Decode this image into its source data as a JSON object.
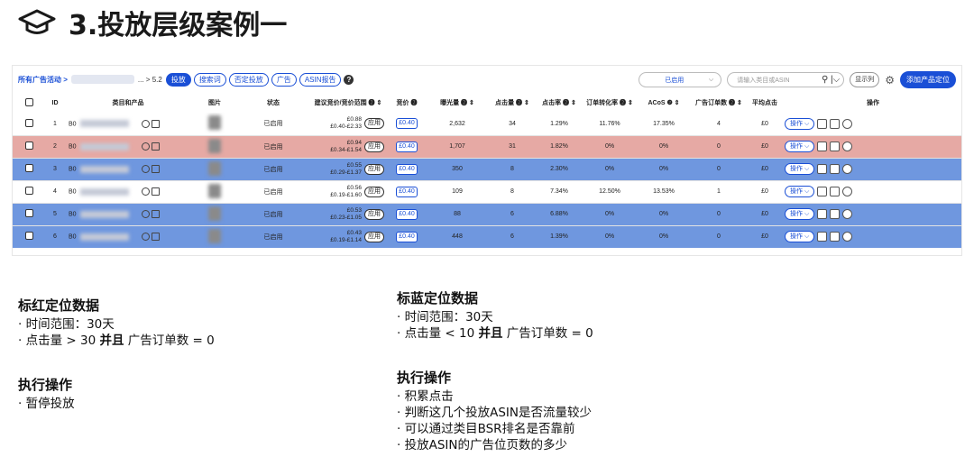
{
  "slide": {
    "title": "3.投放层级案例一",
    "icon": "graduation-cap-icon"
  },
  "toolbar": {
    "crumb_link": "所有广告活动 >",
    "crumb_tail": "... > 5.2",
    "tabs": [
      {
        "label": "投放",
        "active": true
      },
      {
        "label": "搜索词",
        "active": false
      },
      {
        "label": "否定投放",
        "active": false
      },
      {
        "label": "广告",
        "active": false
      },
      {
        "label": "ASIN报告",
        "active": false
      }
    ],
    "status_select": "已启用",
    "search_placeholder": "请输入类目或ASIN",
    "columns_button": "显示列",
    "add_button": "添加产品定位"
  },
  "table": {
    "headers": [
      "",
      "ID",
      "类目和产品",
      "图片",
      "状态",
      "建议竞价/竞价范围",
      "竞价",
      "曝光量",
      "点击量",
      "点击率",
      "订单转化率",
      "ACoS",
      "广告订单数",
      "平均点击",
      "操作"
    ],
    "rows": [
      {
        "style": "white",
        "id": "1",
        "asin": "B0",
        "status": "已启用",
        "bid_top": "£0.88",
        "bid_range": "£0.40-£2.33",
        "bid": "£0.40",
        "impressions": "2,632",
        "clicks": "34",
        "ctr": "1.29%",
        "cvr": "11.76%",
        "acos": "17.35%",
        "orders": "4",
        "avg": "£0"
      },
      {
        "style": "red",
        "id": "2",
        "asin": "B0",
        "status": "已启用",
        "bid_top": "£0.94",
        "bid_range": "£0.34-£1.54",
        "bid": "£0.40",
        "impressions": "1,707",
        "clicks": "31",
        "ctr": "1.82%",
        "cvr": "0%",
        "acos": "0%",
        "orders": "0",
        "avg": "£0"
      },
      {
        "style": "blue",
        "id": "3",
        "asin": "B0",
        "status": "已启用",
        "bid_top": "£0.55",
        "bid_range": "£0.29-£1.37",
        "bid": "£0.40",
        "impressions": "350",
        "clicks": "8",
        "ctr": "2.30%",
        "cvr": "0%",
        "acos": "0%",
        "orders": "0",
        "avg": "£0"
      },
      {
        "style": "white",
        "id": "4",
        "asin": "B0",
        "status": "已启用",
        "bid_top": "£0.56",
        "bid_range": "£0.19-£1.60",
        "bid": "£0.40",
        "impressions": "109",
        "clicks": "8",
        "ctr": "7.34%",
        "cvr": "12.50%",
        "acos": "13.53%",
        "orders": "1",
        "avg": "£0"
      },
      {
        "style": "blue",
        "id": "5",
        "asin": "B0",
        "status": "已启用",
        "bid_top": "£0.53",
        "bid_range": "£0.23-£1.05",
        "bid": "£0.40",
        "impressions": "88",
        "clicks": "6",
        "ctr": "6.88%",
        "cvr": "0%",
        "acos": "0%",
        "orders": "0",
        "avg": "£0"
      },
      {
        "style": "blue",
        "id": "6",
        "asin": "B0",
        "status": "已启用",
        "bid_top": "£0.43",
        "bid_range": "£0.19-£1.14",
        "bid": "£0.40",
        "impressions": "448",
        "clicks": "6",
        "ctr": "1.39%",
        "cvr": "0%",
        "acos": "0%",
        "orders": "0",
        "avg": "£0"
      }
    ],
    "apply_label": "应用",
    "op_label": "操作"
  },
  "notes": {
    "red": {
      "title": "标红定位数据",
      "lines": [
        "· 时间范围：30天",
        "· 点击量 > 30 ",
        "并且",
        " 广告订单数 = 0"
      ]
    },
    "red_action": {
      "title": "执行操作",
      "lines": [
        "· 暂停投放"
      ]
    },
    "blue": {
      "title": "标蓝定位数据",
      "lines": [
        "· 时间范围：30天",
        "· 点击量 < 10 ",
        "并且",
        " 广告订单数 = 0"
      ]
    },
    "blue_action": {
      "title": "执行操作",
      "lines": [
        "· 积累点击",
        "· 判断这几个投放ASIN是否流量较少",
        "· 可以通过类目BSR排名是否靠前",
        "· 投放ASIN的广告位页数的多少"
      ]
    }
  },
  "colors": {
    "red_row": "#e6a9a4",
    "blue_row": "#6f97df",
    "accent": "#1a4fd6"
  }
}
